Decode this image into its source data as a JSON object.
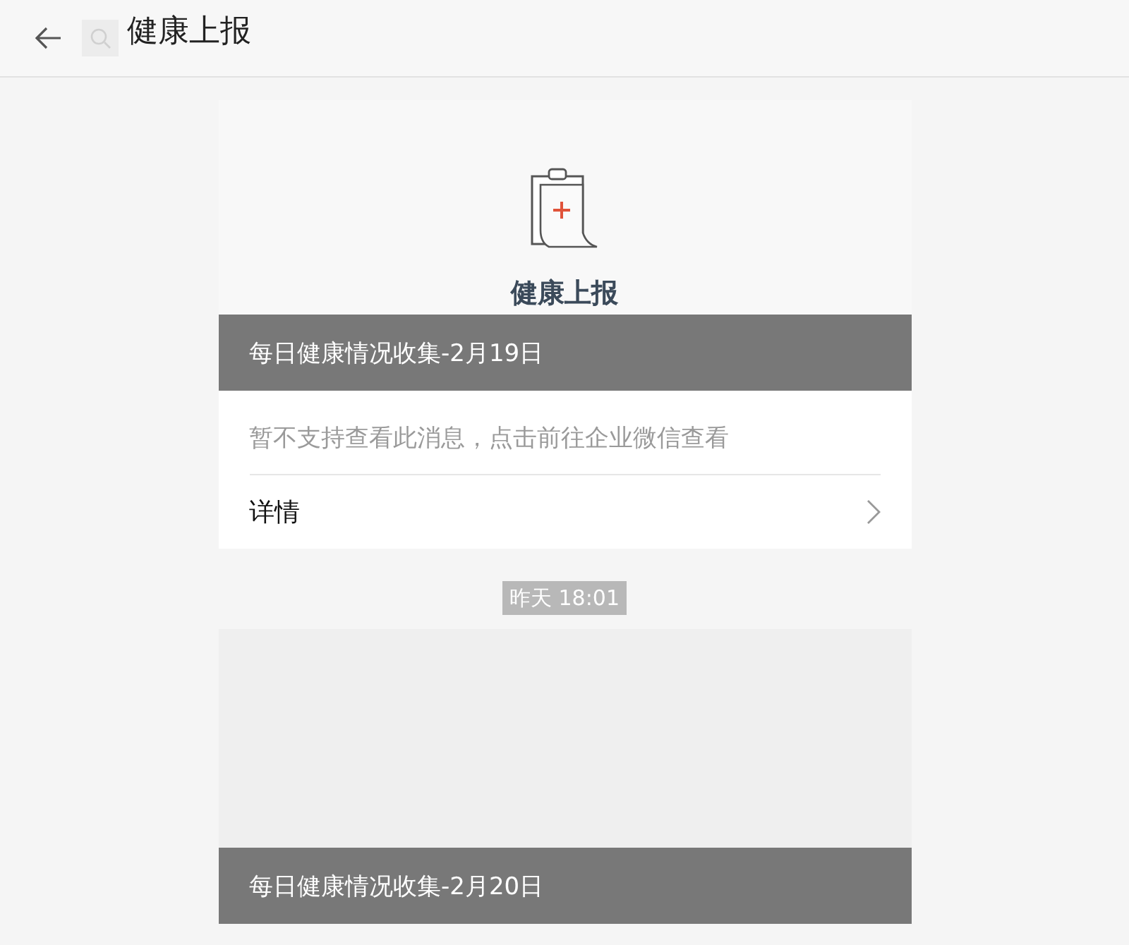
{
  "header": {
    "title": "健康上报"
  },
  "messages": [
    {
      "kind": "card",
      "banner": {
        "kind": "icon",
        "caption": "健康上报"
      },
      "title": "每日健康情况收集-2月19日",
      "notice": "暂不支持查看此消息，点击前往企业微信查看",
      "link": "详情"
    },
    {
      "kind": "timestamp",
      "text": "昨天 18:01"
    },
    {
      "kind": "card",
      "banner": {
        "kind": "blank"
      },
      "title": "每日健康情况收集-2月20日"
    }
  ]
}
